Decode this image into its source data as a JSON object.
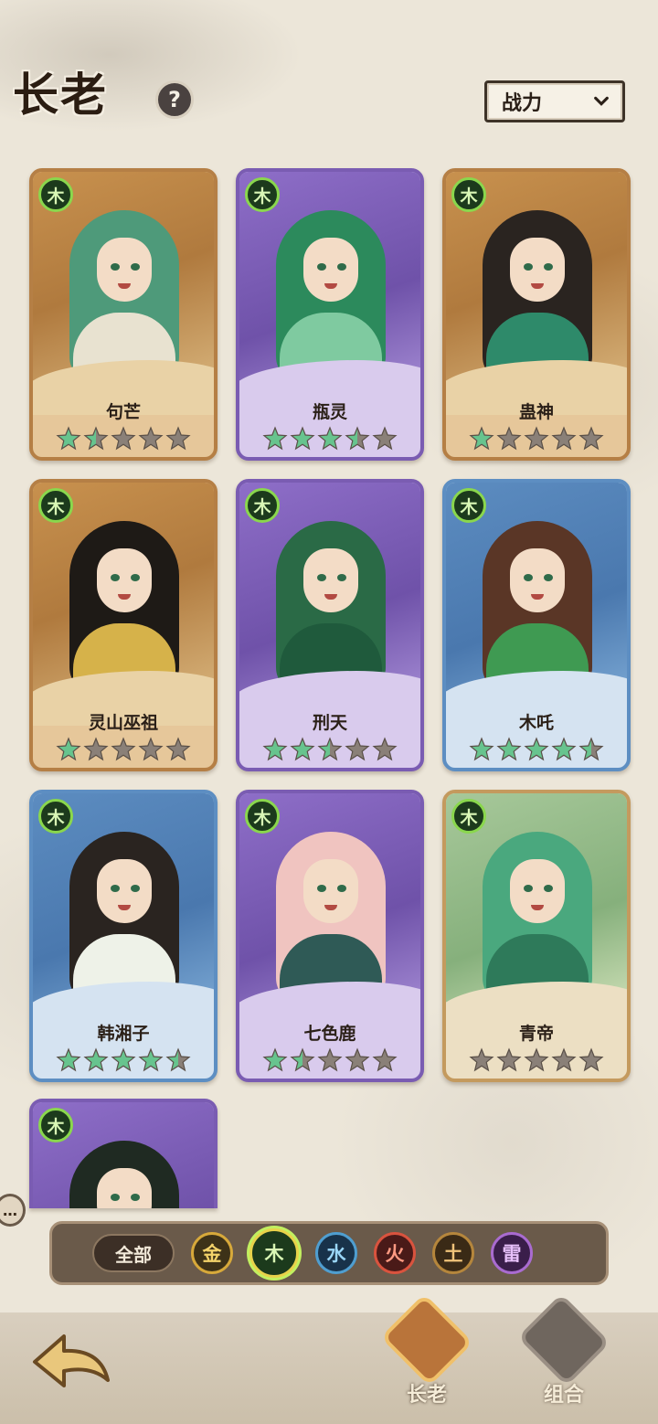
{
  "header": {
    "title": "长老",
    "help_label": "?",
    "sort": {
      "selected": "战力"
    }
  },
  "cards": [
    {
      "name": "句芒",
      "element": "木",
      "stars_total": 5,
      "stars_filled": 1.5,
      "frame": "brown",
      "hair": "#4e9a7a",
      "robe": "#e8e2d0"
    },
    {
      "name": "瓶灵",
      "element": "木",
      "stars_total": 5,
      "stars_filled": 3.5,
      "frame": "purple",
      "hair": "#2c8a5c",
      "robe": "#7fcaa0"
    },
    {
      "name": "蛊神",
      "element": "木",
      "stars_total": 5,
      "stars_filled": 1,
      "frame": "brown",
      "hair": "#2a2420",
      "robe": "#2e8a6a"
    },
    {
      "name": "灵山巫祖",
      "element": "木",
      "stars_total": 5,
      "stars_filled": 1,
      "frame": "brown",
      "hair": "#1e1a16",
      "robe": "#d6b24a"
    },
    {
      "name": "刑天",
      "element": "木",
      "stars_total": 5,
      "stars_filled": 2.5,
      "frame": "purple",
      "hair": "#2a6a46",
      "robe": "#1f5a3c"
    },
    {
      "name": "木吒",
      "element": "木",
      "stars_total": 5,
      "stars_filled": 4.5,
      "frame": "blue",
      "hair": "#5a3626",
      "robe": "#3f9a52"
    },
    {
      "name": "韩湘子",
      "element": "木",
      "stars_total": 5,
      "stars_filled": 4.5,
      "frame": "blue",
      "hair": "#2a2420",
      "robe": "#eef2e8"
    },
    {
      "name": "七色鹿",
      "element": "木",
      "stars_total": 5,
      "stars_filled": 1.5,
      "frame": "purple",
      "hair": "#f0c4c0",
      "robe": "#2f5a56"
    },
    {
      "name": "青帝",
      "element": "木",
      "stars_total": 5,
      "stars_filled": 0,
      "frame": "green",
      "hair": "#4aa87e",
      "robe": "#2e7a5a"
    },
    {
      "name": "",
      "element": "木",
      "stars_total": 0,
      "stars_filled": 0,
      "frame": "purple",
      "hair": "#1f2a22",
      "robe": "#2a4a36"
    }
  ],
  "filters": {
    "all_label": "全部",
    "elements": [
      {
        "label": "金",
        "key": "gold"
      },
      {
        "label": "木",
        "key": "wood",
        "selected": true
      },
      {
        "label": "水",
        "key": "water"
      },
      {
        "label": "火",
        "key": "fire"
      },
      {
        "label": "土",
        "key": "earth"
      },
      {
        "label": "雷",
        "key": "thunder"
      }
    ]
  },
  "chat_label": "…",
  "nav": {
    "elder_label": "长老",
    "combo_label": "组合"
  },
  "colors": {
    "star_on": "#67c48e",
    "star_off": "#8a8078",
    "wood_accent": "#8ad74d"
  }
}
